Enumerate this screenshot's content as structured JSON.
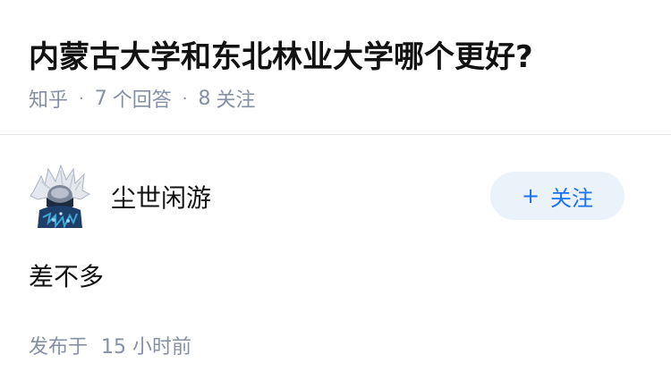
{
  "question": {
    "title": "内蒙古大学和东北林业大学哪个更好?",
    "source": "知乎",
    "answer_count": "7",
    "answer_label": "个回答",
    "follower_count": "8",
    "follower_label": "关注"
  },
  "answer": {
    "author": {
      "name": "尘世闲游",
      "avatar_icon": "avatar-illustration"
    },
    "follow_button": {
      "icon": "plus-icon",
      "plus": "+",
      "label": "关注",
      "background": "#ebf2fa",
      "color": "#1772f6"
    },
    "content": "差不多",
    "published_prefix": "发布于",
    "published_time": "15 小时前"
  },
  "colors": {
    "text": "#121212",
    "meta": "#8590a6",
    "divider": "#ebebeb"
  }
}
